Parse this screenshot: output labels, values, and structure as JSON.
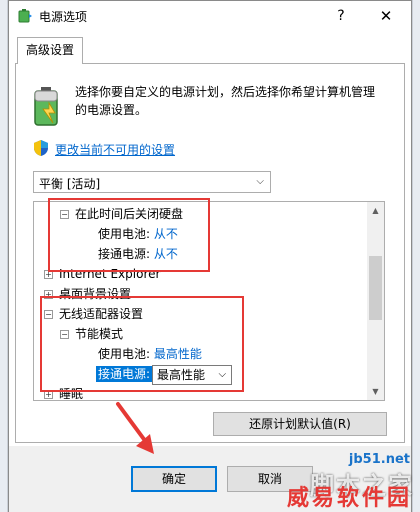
{
  "window": {
    "title": "电源选项",
    "help_label": "?",
    "close_label": "✕"
  },
  "tab": {
    "label": "高级设置"
  },
  "intro": {
    "text": "选择你要自定义的电源计划，然后选择你希望计算机管理的电源设置。"
  },
  "change_link": {
    "label": "更改当前不可用的设置"
  },
  "plan_combo": {
    "value": "平衡 [活动]"
  },
  "tree": {
    "harddisk": {
      "label": "在此时间后关闭硬盘",
      "battery_label": "使用电池:",
      "battery_value": "从不",
      "plugged_label": "接通电源:",
      "plugged_value": "从不"
    },
    "ie": {
      "label": "Internet Explorer"
    },
    "desktop": {
      "label": "桌面背景设置"
    },
    "wireless": {
      "label": "无线适配器设置",
      "mode_label": "节能模式",
      "battery_label": "使用电池:",
      "battery_value": "最高性能",
      "plugged_label": "接通电源:",
      "plugged_value": "最高性能"
    },
    "sleep": {
      "label": "睡眠"
    }
  },
  "buttons": {
    "restore": "还原计划默认值(R)",
    "ok": "确定",
    "cancel": "取消"
  },
  "watermark": {
    "site": "jb51.net",
    "brand_en": "脚本之家",
    "brand_cn": "威易软件园"
  },
  "colors": {
    "accent": "#0078d7",
    "link": "#0066cc",
    "highlight": "#e53935"
  }
}
